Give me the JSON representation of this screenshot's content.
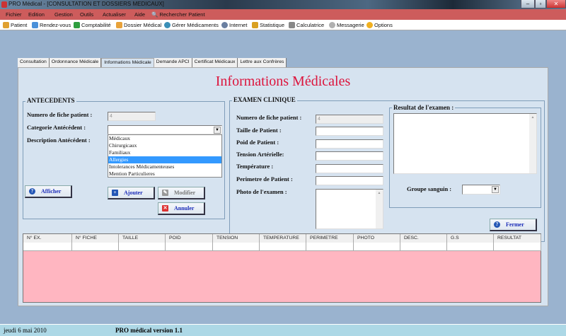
{
  "window": {
    "title": "PRO Médical - [CONSULTATION ET DOSSIERS MEDICAUX]",
    "controls": [
      "–",
      "▫",
      "✕"
    ]
  },
  "menu": [
    "Fichier",
    "Edition",
    "Gestion",
    "Outils",
    "Actualiser",
    "Aide",
    "Rechercher Patient"
  ],
  "toolbar": [
    {
      "label": "Patient",
      "icon": "patient-icon",
      "color": "#e0a030"
    },
    {
      "label": "Rendez-vous",
      "icon": "calendar-icon",
      "color": "#4a90d9"
    },
    {
      "label": "Comptabilité",
      "icon": "dollar-icon",
      "color": "#2e9e3e"
    },
    {
      "label": "Dossier Médical",
      "icon": "folder-icon",
      "color": "#e8a23a"
    },
    {
      "label": "Gérer Médicaments",
      "icon": "medicine-icon",
      "color": "#3a8fb7"
    },
    {
      "label": "Internet",
      "icon": "globe-icon",
      "color": "#6a7fa0"
    },
    {
      "label": "Statistique",
      "icon": "chart-icon",
      "color": "#d9a020"
    },
    {
      "label": "Calculatrice",
      "icon": "calculator-icon",
      "color": "#888888"
    },
    {
      "label": "Messagerie",
      "icon": "mail-icon",
      "color": "#b0b0b0"
    },
    {
      "label": "Options",
      "icon": "star-icon",
      "color": "#f0b020"
    }
  ],
  "tabs": [
    {
      "label": "Consultation"
    },
    {
      "label": "Ordonnance Médicale"
    },
    {
      "label": "Informations Médicale",
      "active": true
    },
    {
      "label": "Demande APCI"
    },
    {
      "label": "Certificat Médicaux"
    },
    {
      "label": "Lettre aux Confrères"
    }
  ],
  "page_title": "Informations Médicales",
  "antecedents": {
    "legend": "ANTECEDENTS",
    "fiche_label": "Numero de fiche patient :",
    "fiche_value": "4",
    "categorie_label": "Categorie Antécédent :",
    "categorie_value": "",
    "description_label": "Description Antécédent :",
    "options": [
      "Médicaux",
      "Chirurgicaux",
      "Familiaux",
      "Allergies",
      "Intolerances Médicamenteuses",
      "Mention Particulieres"
    ],
    "selected_option": "Allergies",
    "buttons": {
      "afficher": "Afficher",
      "ajouter": "Ajouter",
      "modifier": "Modifier",
      "annuler": "Annuler"
    }
  },
  "examen": {
    "legend": "EXAMEN CLINIQUE",
    "fields": [
      {
        "label": "Numero de fiche patient :",
        "value": "4",
        "disabled": true
      },
      {
        "label": "Taille de Patient :",
        "value": ""
      },
      {
        "label": "Poid de Patient :",
        "value": ""
      },
      {
        "label": "Tension Artérielle:",
        "value": ""
      },
      {
        "label": "Température :",
        "value": ""
      },
      {
        "label": "Perimetre de Patient :",
        "value": ""
      }
    ],
    "photo_label": "Photo de l'examen  :",
    "resultat_legend": "Resultat de l'examen  :",
    "groupe_label": "Groupe sanguin :",
    "groupe_value": "",
    "fermer": "Fermer"
  },
  "table": {
    "columns": [
      "N° EX.",
      "N° FICHE",
      "TAILLE",
      "POID",
      "TENSION",
      "TEMPERATURE",
      "PERIMETRE",
      "PHOTO",
      "DESC.",
      "G.S",
      "RESULTAT"
    ],
    "rows": []
  },
  "status": {
    "date": "jeudi 6 mai 2010",
    "version": "PRO médical version 1.1"
  },
  "colors": {
    "menubar": "#cd5c5c",
    "panel": "#d6e3f0",
    "title": "#dc143c",
    "grid": "#ffb6c1",
    "status": "#add8e6",
    "selection": "#3399ff"
  }
}
